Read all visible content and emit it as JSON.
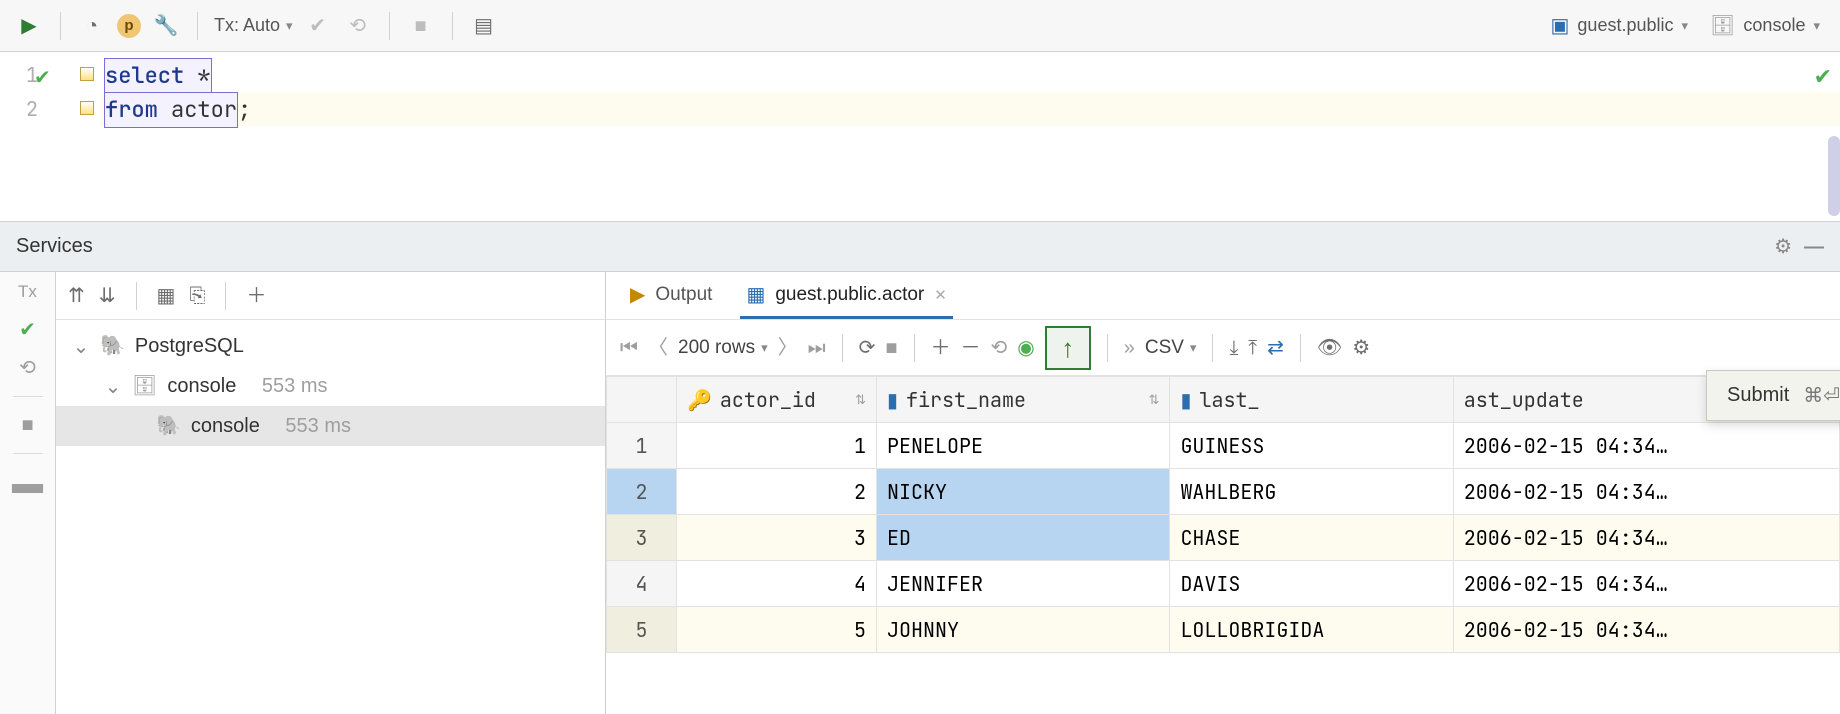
{
  "toolbar": {
    "tx_label": "Tx: Auto",
    "schema": "guest.public",
    "console": "console",
    "p_badge": "p"
  },
  "editor": {
    "lines": [
      "select *",
      "from actor;"
    ],
    "line_numbers": [
      "1",
      "2"
    ]
  },
  "services": {
    "title": "Services",
    "tx_short": "Tx"
  },
  "tree": {
    "root": "PostgreSQL",
    "console_label": "console",
    "console_time": "553 ms",
    "child_label": "console",
    "child_time": "553 ms"
  },
  "tabs": {
    "output": "Output",
    "actor": "guest.public.actor"
  },
  "result_toolbar": {
    "rows_label": "200 rows",
    "csv_label": "CSV",
    "more_glyph": "»"
  },
  "tooltip": {
    "text": "Submit",
    "shortcut": "⌘⏎"
  },
  "columns": [
    "actor_id",
    "first_name",
    "last_",
    "ast_update"
  ],
  "rows": [
    {
      "n": "1",
      "id": "1",
      "first": "PENELOPE",
      "last": "GUINESS",
      "upd": "2006-02-15 04:34…"
    },
    {
      "n": "2",
      "id": "2",
      "first": "NICKY",
      "last": "WAHLBERG",
      "upd": "2006-02-15 04:34…"
    },
    {
      "n": "3",
      "id": "3",
      "first": "ED",
      "last": "CHASE",
      "upd": "2006-02-15 04:34…"
    },
    {
      "n": "4",
      "id": "4",
      "first": "JENNIFER",
      "last": "DAVIS",
      "upd": "2006-02-15 04:34…"
    },
    {
      "n": "5",
      "id": "5",
      "first": "JOHNNY",
      "last": "LOLLOBRIGIDA",
      "upd": "2006-02-15 04:34…"
    }
  ]
}
